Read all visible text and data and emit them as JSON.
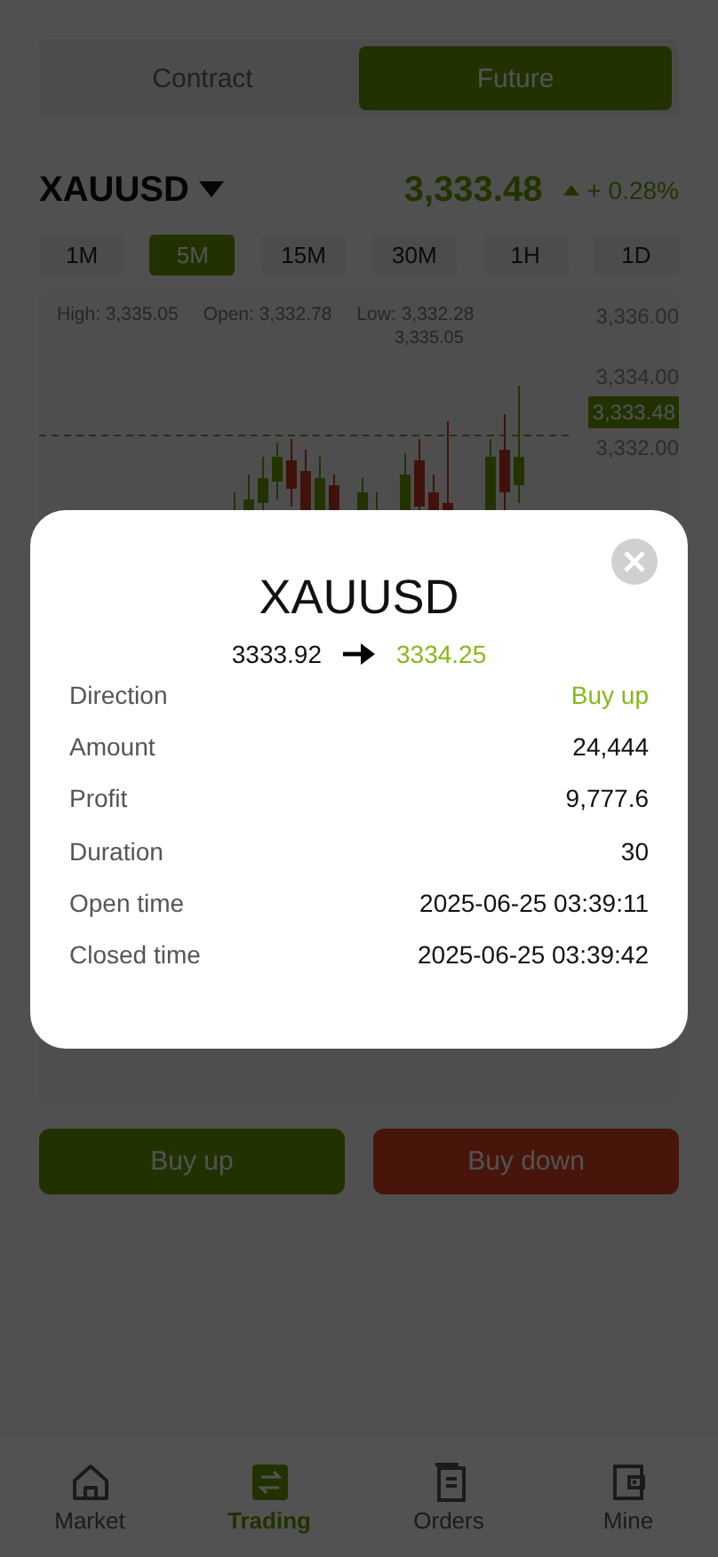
{
  "mode_tabs": [
    {
      "label": "Contract",
      "selected": false
    },
    {
      "label": "Future",
      "selected": true
    }
  ],
  "symbol": {
    "name": "XAUUSD",
    "price": "3,333.48",
    "change": "+ 0.28%"
  },
  "intervals": [
    {
      "label": "1M",
      "selected": false
    },
    {
      "label": "5M",
      "selected": true
    },
    {
      "label": "15M",
      "selected": false
    },
    {
      "label": "30M",
      "selected": false
    },
    {
      "label": "1H",
      "selected": false
    },
    {
      "label": "1D",
      "selected": false
    }
  ],
  "chart": {
    "stats": [
      "High: 3,335.05",
      "Open: 3,332.78",
      "Low: 3,332.28"
    ],
    "high_marker": "3,335.05",
    "price_axis": [
      "3,336.00",
      "3,334.00",
      "3,332.00"
    ],
    "current_price_tag": "3,333.48"
  },
  "actions": [
    {
      "label": "Buy up",
      "kind": "up"
    },
    {
      "label": "Buy down",
      "kind": "down"
    }
  ],
  "bottom_nav": [
    {
      "label": "Market",
      "kind": "home",
      "selected": false
    },
    {
      "label": "Trading",
      "kind": "exchange",
      "selected": true
    },
    {
      "label": "Orders",
      "kind": "documents",
      "selected": false
    },
    {
      "label": "Mine",
      "kind": "wallet",
      "selected": false
    }
  ],
  "dialog": {
    "title": "XAUUSD",
    "open_price": "3333.92",
    "close_price": "3334.25",
    "rows": [
      {
        "label": "Direction",
        "value": "Buy up",
        "highlight": true
      },
      {
        "label": "Amount",
        "value": "24,444",
        "highlight": false
      },
      {
        "label": "Profit",
        "value": "9,777.6",
        "highlight": false
      },
      {
        "label": "Duration",
        "value": "30",
        "highlight": false
      },
      {
        "label": "Open time",
        "value": "2025-06-25 03:39:11",
        "highlight": false
      },
      {
        "label": "Closed time",
        "value": "2025-06-25 03:39:42",
        "highlight": false
      }
    ]
  }
}
